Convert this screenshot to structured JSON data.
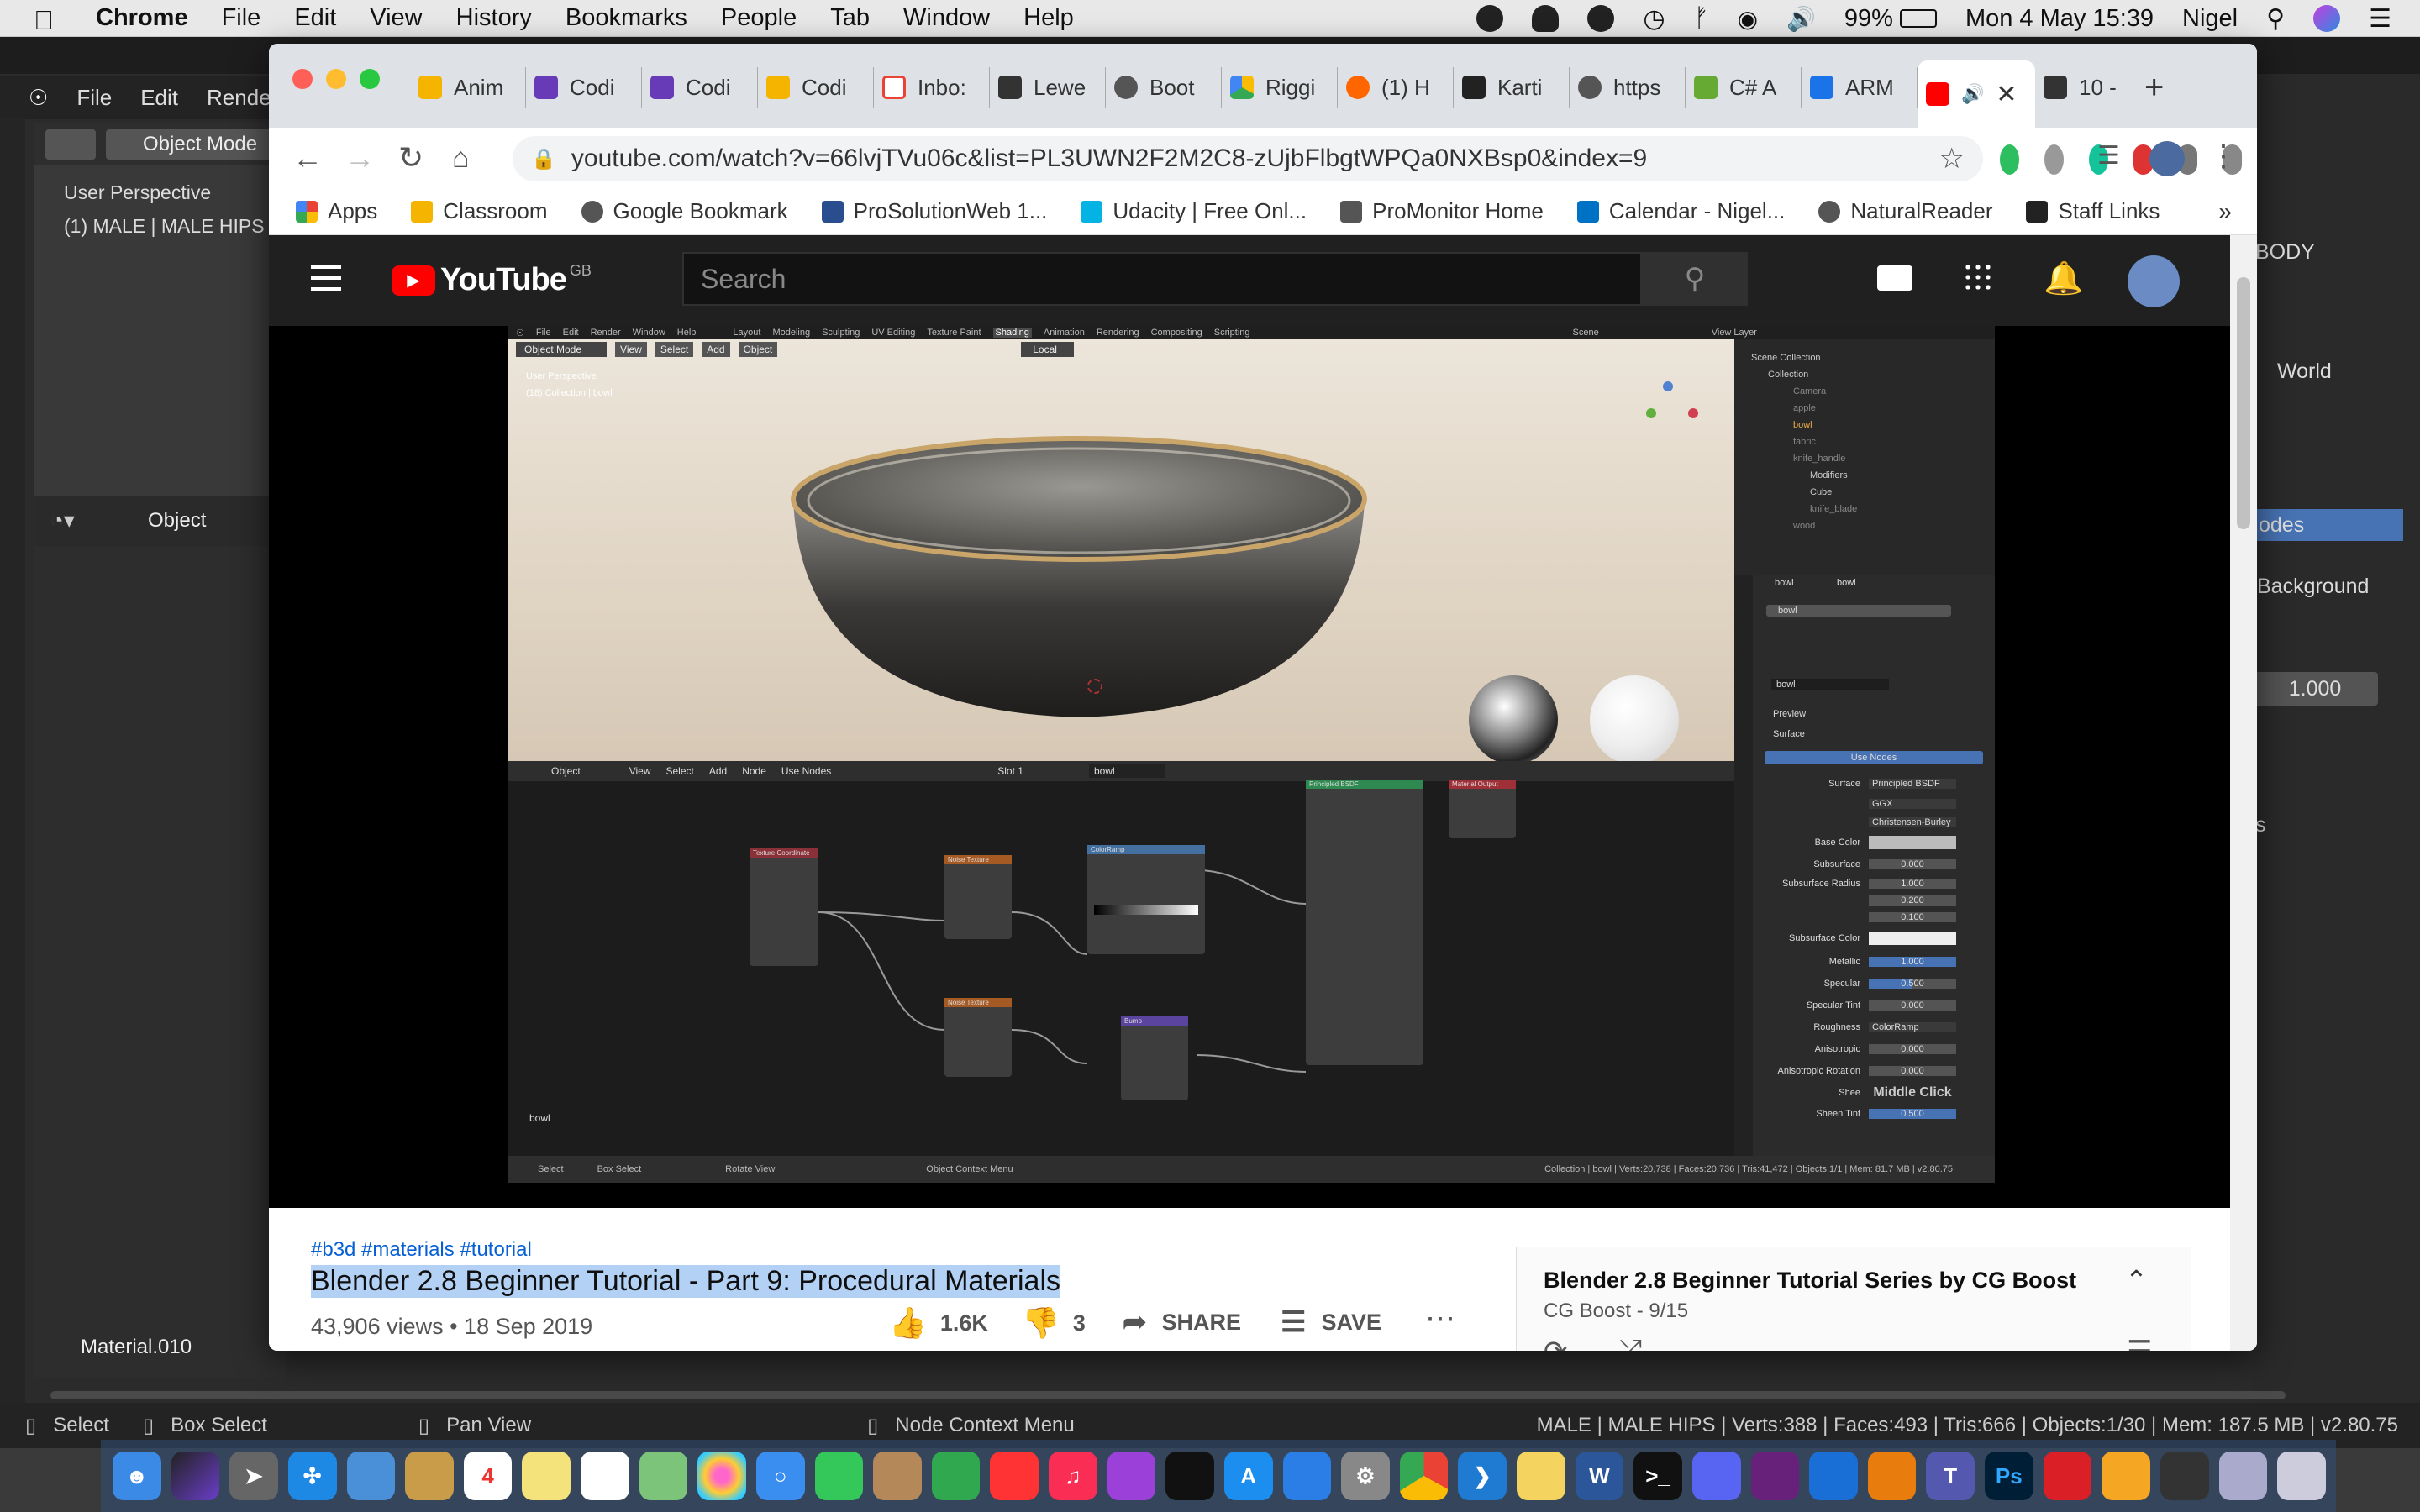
{
  "menubar": {
    "app": "Chrome",
    "items": [
      "File",
      "Edit",
      "View",
      "History",
      "Bookmarks",
      "People",
      "Tab",
      "Window",
      "Help"
    ],
    "battery": "99%",
    "datetime": "Mon 4 May  15:39",
    "user": "Nigel"
  },
  "blender": {
    "menu": [
      "File",
      "Edit",
      "Render"
    ],
    "mode": "Object Mode",
    "viewport_label": "User Perspective",
    "viewport_sub": "(1) MALE | MALE HIPS",
    "editor_label": "Object",
    "material": "Material.010",
    "right": {
      "body": "BODY",
      "world": "World",
      "nodes": "odes",
      "background": "Background",
      "value": "1.000",
      "s": "s"
    },
    "status": {
      "select": "Select",
      "box_select": "Box Select",
      "pan_view": "Pan View",
      "node_menu": "Node Context Menu",
      "stats": "MALE | MALE HIPS | Verts:388 | Faces:493 | Tris:666 | Objects:1/30 | Mem: 187.5 MB | v2.80.75"
    }
  },
  "chrome": {
    "tabs": [
      "Anim",
      "Codi",
      "Codi",
      "Codi",
      "Inbo:",
      "Lewe",
      "Boot",
      "Riggi",
      "(1) H",
      "Karti",
      "https",
      "C# A",
      "ARM",
      "",
      "10 -"
    ],
    "url": "youtube.com/watch?v=66lvjTVu06c&list=PL3UWN2F2M2C8-zUjbFlbgtWPQa0NXBsp0&index=9",
    "bookmarks": [
      "Apps",
      "Classroom",
      "Google Bookmark",
      "ProSolutionWeb 1...",
      "Udacity | Free Onl...",
      "ProMonitor Home",
      "Calendar - Nigel...",
      "NaturalReader",
      "Staff Links"
    ],
    "more": "»"
  },
  "youtube": {
    "logo": "YouTube",
    "region": "GB",
    "search_placeholder": "Search",
    "hashtags": "#b3d #materials #tutorial",
    "title": "Blender 2.8 Beginner Tutorial - Part 9: Procedural Materials",
    "meta": "43,906 views • 18 Sep 2019",
    "likes": "1.6K",
    "dislikes": "3",
    "share": "SHARE",
    "save": "SAVE",
    "playlist_title": "Blender 2.8 Beginner Tutorial Series by CG Boost",
    "playlist_sub": "CG Boost - 9/15"
  },
  "video": {
    "menu": [
      "File",
      "Edit",
      "Render",
      "Window",
      "Help"
    ],
    "workspaces": [
      "Layout",
      "Modeling",
      "Sculpting",
      "UV Editing",
      "Texture Paint",
      "Shading",
      "Animation",
      "Rendering",
      "Compositing",
      "Scripting"
    ],
    "scene": "Scene",
    "view_layer": "View Layer",
    "mode": "Object Mode",
    "hdr": [
      "View",
      "Select",
      "Add",
      "Object"
    ],
    "local": "Local",
    "vp_label": "User Perspective",
    "vp_sub": "(18) Collection | bowl",
    "outliner": [
      "Scene Collection",
      "Collection",
      "Camera",
      "apple",
      "bowl",
      "fabric",
      "knife_handle",
      "Modifiers",
      "Cube",
      "knife_blade",
      "wood"
    ],
    "node_hdr": [
      "Object",
      "View",
      "Select",
      "Add",
      "Node",
      "Use Nodes",
      "Slot 1",
      "bowl"
    ],
    "nodes": [
      "Texture Coordinate",
      "Noise Texture",
      "ColorRamp",
      "Noise Texture",
      "Bump",
      "Principled BSDF",
      "Material Output"
    ],
    "node_label": "bowl",
    "props": {
      "obj": "bowl",
      "mat": "bowl",
      "slot": "bowl",
      "mat2": "bowl",
      "preview": "Preview",
      "surface": "Surface",
      "use_nodes": "Use Nodes",
      "rows": [
        {
          "k": "Surface",
          "v": "Principled BSDF"
        },
        {
          "k": "",
          "v": "GGX"
        },
        {
          "k": "",
          "v": "Christensen-Burley"
        },
        {
          "k": "Base Color",
          "v": ""
        },
        {
          "k": "Subsurface",
          "v": "0.000"
        },
        {
          "k": "Subsurface Radius",
          "v": "1.000"
        },
        {
          "k": "",
          "v": "0.200"
        },
        {
          "k": "",
          "v": "0.100"
        },
        {
          "k": "Subsurface Color",
          "v": ""
        },
        {
          "k": "Metallic",
          "v": "1.000"
        },
        {
          "k": "Specular",
          "v": "0.500"
        },
        {
          "k": "Specular Tint",
          "v": "0.000"
        },
        {
          "k": "Roughness",
          "v": "ColorRamp"
        },
        {
          "k": "Anisotropic",
          "v": "0.000"
        },
        {
          "k": "Anisotropic Rotation",
          "v": "0.000"
        },
        {
          "k": "Shee",
          "v": "Middle Click"
        },
        {
          "k": "Sheen Tint",
          "v": "0.500"
        }
      ]
    },
    "status": [
      "Select",
      "Box Select",
      "Rotate View",
      "Object Context Menu"
    ],
    "status_right": "Collection | bowl | Verts:20,738 | Faces:20,736 | Tris:41,472 | Objects:1/1 | Mem: 81.7 MB | v2.80.75"
  }
}
